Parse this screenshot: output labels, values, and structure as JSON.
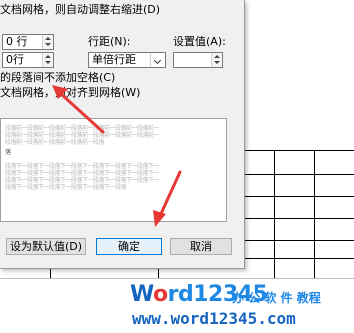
{
  "dialog": {
    "grid_right_indent_label": "文档网格，则自动调整右缩进(D)",
    "before_value": "0 行",
    "after_value": "0行",
    "line_spacing_label": "行距(N):",
    "line_spacing_value": "单倍行距",
    "set_value_label": "设置值(A):",
    "set_value": "",
    "no_space_same_style_label": "的段落间不添加空格(C)",
    "snap_to_grid_label": "文档网格，则对齐到网格(W)",
    "preview_sample_line": "段落前一段落前一段落前一段落前一段落前一段落前一段落前一",
    "preview_mid_line": "段落前一段落前一段落前一段落前一段落",
    "preview_small_text": "落",
    "preview_sample_after": "段落下一段落下一段落下一段落下一段落下一段落下一段落下一",
    "preview_after_short": "段落下一段落下一段落下一段落下一段落下一段落",
    "set_default_button": "设为默认值(D)",
    "ok_button": "确定",
    "cancel_button": "取消"
  },
  "watermark": {
    "logo_w": "W",
    "logo_o": "o",
    "logo_rest": "rd12345",
    "tagline": "办 公 软 件 教程",
    "url": "www.word12345.com"
  },
  "colors": {
    "dialog_bg": "#f0f0f0",
    "arrow": "#e53935",
    "watermark_blue": "#1e88e5",
    "watermark_red": "#e53935"
  }
}
